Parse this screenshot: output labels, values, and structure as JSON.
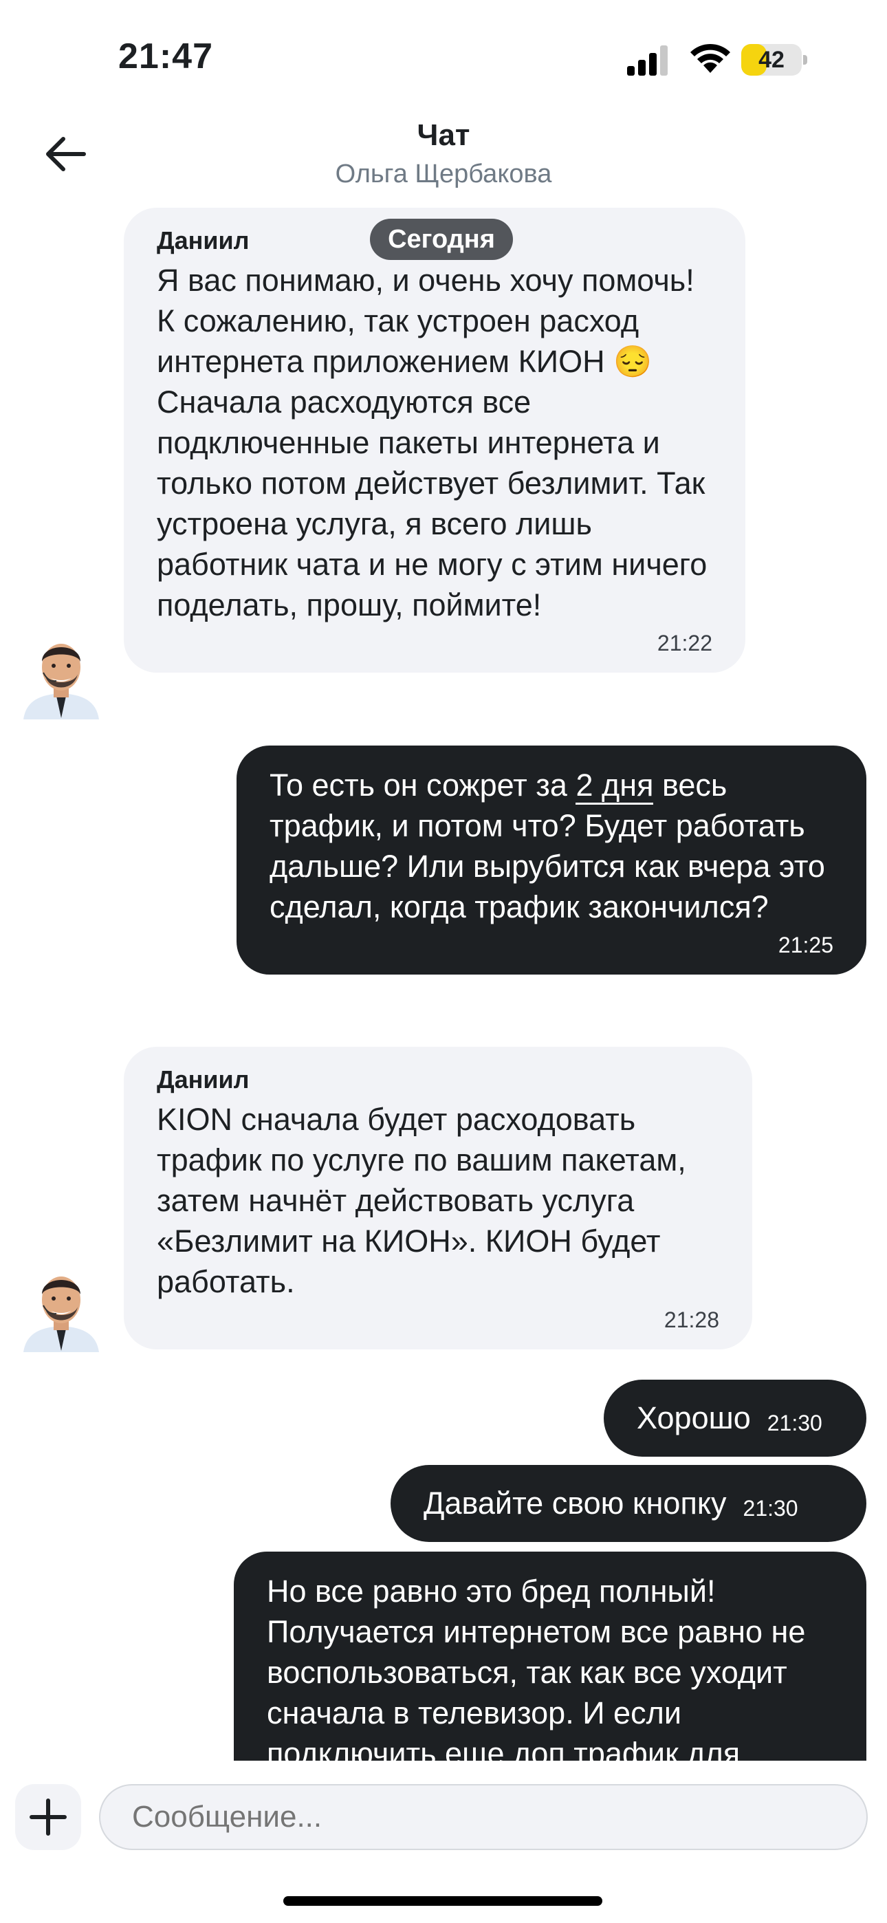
{
  "status_bar": {
    "time": "21:47",
    "battery": "42",
    "battery_level": 0.42,
    "battery_color": "#f5d40f"
  },
  "header": {
    "title": "Чат",
    "subtitle": "Ольга Щербакова"
  },
  "date_separator": "Сегодня",
  "messages": [
    {
      "direction": "in",
      "sender": "Даниил",
      "text": "Я вас понимаю, и очень хочу помочь! К сожалению, так устроен расход интернета приложением КИОН 😔\nСначала расходуются все подключенные пакеты интернета и только потом действует безлимит. Так устроена услуга, я всего лишь работник чата и не могу с этим ничего поделать, прошу, поймите!",
      "time": "21:22"
    },
    {
      "direction": "out",
      "text_before": "То есть он сожрет за ",
      "text_underlined": "2 дня",
      "text_after": " весь трафик, и потом что? Будет работать дальше? Или вырубится как вчера это сделал, когда трафик закончился?",
      "time": "21:25"
    },
    {
      "direction": "in",
      "sender": "Даниил",
      "text": "KION сначала будет расходовать трафик по услуге по вашим пакетам, затем начнёт действовать услуга «Безлимит на КИОН». КИОН будет работать.",
      "time": "21:28"
    },
    {
      "direction": "out",
      "text": "Хорошо",
      "time": "21:30"
    },
    {
      "direction": "out",
      "text": "Давайте свою кнопку",
      "time": "21:30"
    },
    {
      "direction": "out",
      "text": "Но все равно это бред полный! Получается интернетом все равно не воспользоваться, так как все уходит сначала в телевизор. И если подключить еще доп трафик для"
    }
  ],
  "composer": {
    "placeholder": "Сообщение..."
  },
  "colors": {
    "incoming_bubble": "#f2f3f7",
    "outgoing_bubble": "#1d2023",
    "accent_yellow": "#f5d40f"
  },
  "icons": [
    "signal-icon",
    "wifi-icon",
    "battery-icon",
    "back-arrow-icon",
    "plus-icon",
    "avatar-agent"
  ]
}
